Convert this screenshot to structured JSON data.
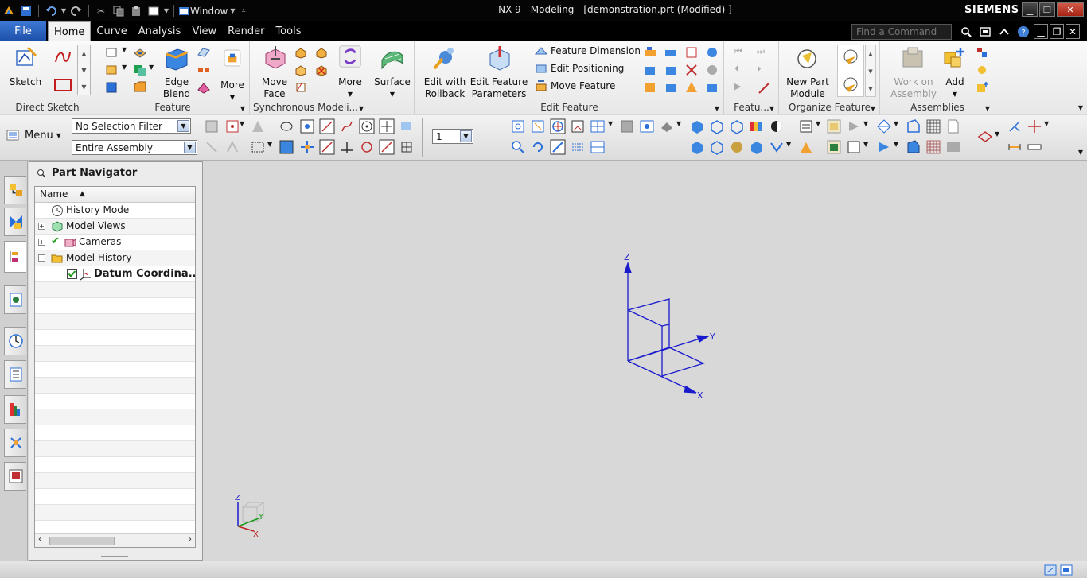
{
  "window": {
    "title": "NX 9 - Modeling - [demonstration.prt (Modified) ]",
    "brand": "SIEMENS",
    "quick_access_window_label": "Window"
  },
  "menu": {
    "file_label": "File",
    "tabs": [
      "Home",
      "Curve",
      "Analysis",
      "View",
      "Render",
      "Tools"
    ],
    "active_tab": "Home",
    "find_command_placeholder": "Find a Command"
  },
  "ribbon": {
    "direct_sketch": {
      "sketch": "Sketch",
      "group_label": "Direct Sketch"
    },
    "feature": {
      "edge_blend_1": "Edge",
      "edge_blend_2": "Blend",
      "more": "More",
      "group_label": "Feature"
    },
    "synchronous": {
      "move_face_1": "Move",
      "move_face_2": "Face",
      "more": "More",
      "surface": "Surface",
      "group_label": "Synchronous Modeli..."
    },
    "edit_feature": {
      "edit_rollback_1": "Edit with",
      "edit_rollback_2": "Rollback",
      "edit_params_1": "Edit Feature",
      "edit_params_2": "Parameters",
      "feature_dimension": "Feature Dimension",
      "edit_positioning": "Edit Positioning",
      "move_feature": "Move Feature",
      "group_label": "Edit Feature"
    },
    "featu_group_label": "Featu...",
    "organize": {
      "new_part_1": "New Part",
      "new_part_2": "Module",
      "group_label": "Organize Feature"
    },
    "assemblies": {
      "work_on_1": "Work on",
      "work_on_2": "Assembly",
      "add": "Add",
      "group_label": "Assemblies"
    }
  },
  "toolbar": {
    "menu_label": "Menu",
    "selection_filter": "No Selection Filter",
    "selection_scope": "Entire Assembly",
    "layer_value": "1"
  },
  "part_navigator": {
    "title": "Part Navigator",
    "column_name": "Name",
    "items": [
      {
        "label": "History Mode"
      },
      {
        "label": "Model Views"
      },
      {
        "label": "Cameras"
      },
      {
        "label": "Model History"
      },
      {
        "label": "Datum Coordina..."
      }
    ]
  },
  "graphics": {
    "axis_z": "Z",
    "axis_y": "Y",
    "axis_x": "X",
    "triad_z": "Z",
    "triad_y": "Y",
    "triad_x": "X"
  },
  "colors": {
    "datum_blue": "#1a1acd",
    "titlebar": "#050505",
    "file_button": "#2a5fb8",
    "graphics_bg": "#d8d8d8"
  }
}
